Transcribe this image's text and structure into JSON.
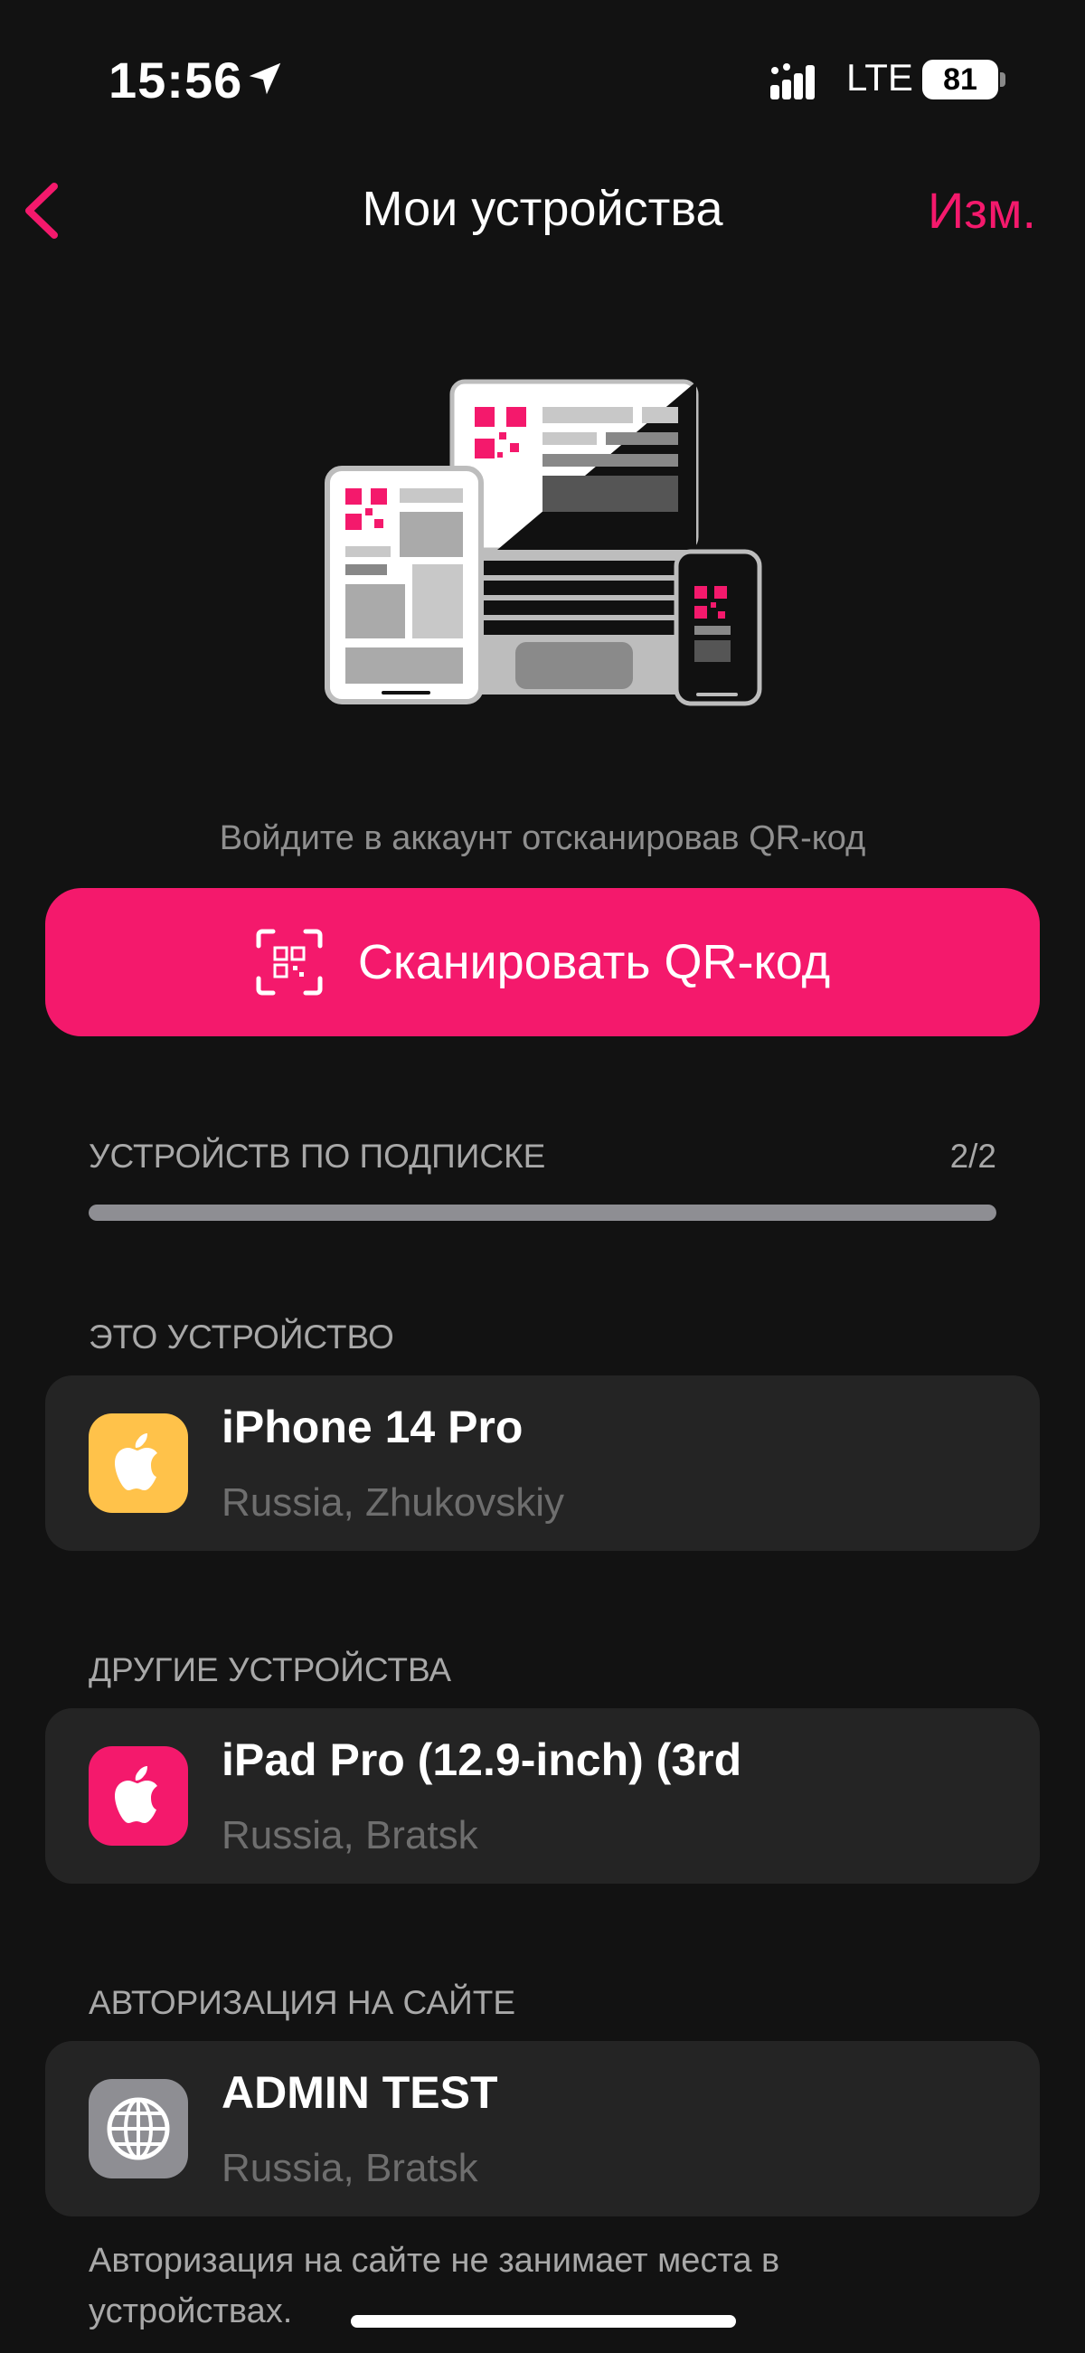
{
  "status_bar": {
    "time": "15:56",
    "network": "LTE",
    "battery": "81"
  },
  "nav": {
    "title": "Мои устройства",
    "edit_label": "Изм."
  },
  "hint": "Войдите в аккаунт отсканировав QR-код",
  "scan_button": {
    "label": "Сканировать QR-код"
  },
  "subscription": {
    "label": "УСТРОЙСТВ ПО ПОДПИСКЕ",
    "count": "2/2",
    "progress_fraction": 1.0
  },
  "this_device": {
    "section_label": "ЭТО УСТРОЙСТВО",
    "name": "iPhone 14 Pro",
    "location": "Russia, Zhukovskiy",
    "icon": "apple-icon",
    "icon_color": "#ffc24a"
  },
  "other_devices": {
    "section_label": "ДРУГИЕ УСТРОЙСТВА",
    "name": "iPad Pro (12.9-inch) (3rd",
    "location": "Russia, Bratsk",
    "icon": "apple-icon",
    "icon_color": "#f4196c"
  },
  "web_auth": {
    "section_label": "АВТОРИЗАЦИЯ НА САЙТЕ",
    "name": "ADMIN TEST",
    "location": "Russia, Bratsk",
    "icon": "globe-icon",
    "icon_color": "#8e8e93",
    "footnote": "Авторизация на сайте не занимает места в устройствах."
  },
  "colors": {
    "accent": "#f4196c",
    "background": "#121212",
    "card": "#242424"
  }
}
